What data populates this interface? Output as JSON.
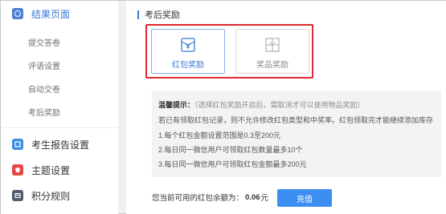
{
  "sidebar": {
    "result_page": {
      "label": "结果页面",
      "icon": "gear-icon"
    },
    "sub_items": [
      {
        "label": "提交答卷"
      },
      {
        "label": "评语设置"
      },
      {
        "label": "自动交卷"
      },
      {
        "label": "考后奖励"
      }
    ],
    "sections": [
      {
        "label": "考生报告设置",
        "icon": "report-icon"
      },
      {
        "label": "主题设置",
        "icon": "theme-icon"
      },
      {
        "label": "积分规则",
        "icon": "points-icon"
      }
    ]
  },
  "main": {
    "title": "考后奖励",
    "reward_options": [
      {
        "label": "红包奖励",
        "icon": "red-envelope-icon",
        "selected": true
      },
      {
        "label": "奖品奖励",
        "icon": "gift-icon",
        "selected": false
      }
    ],
    "tips": {
      "heading": "温馨提示：",
      "note": "（选择红包奖励开启后，需取消才可以使用物品奖励）",
      "lines": [
        "若已有领取红包记录，则不允许修改红包类型和中奖率。红包领取完才能继续添加库存",
        "1.每个红包金额设置范围是0.3至200元",
        "2.每日同一微信用户可领取红包数量最多10个",
        "3.每日同一微信用户可领取红包金额最多200元"
      ]
    },
    "balance": {
      "label": "您当前可用的红包余额为：",
      "amount": "0.06",
      "unit": "元"
    },
    "recharge_label": "充值"
  },
  "colors": {
    "accent": "#3b78d8",
    "highlight_border": "#e0292f",
    "button": "#3c8ff0"
  }
}
